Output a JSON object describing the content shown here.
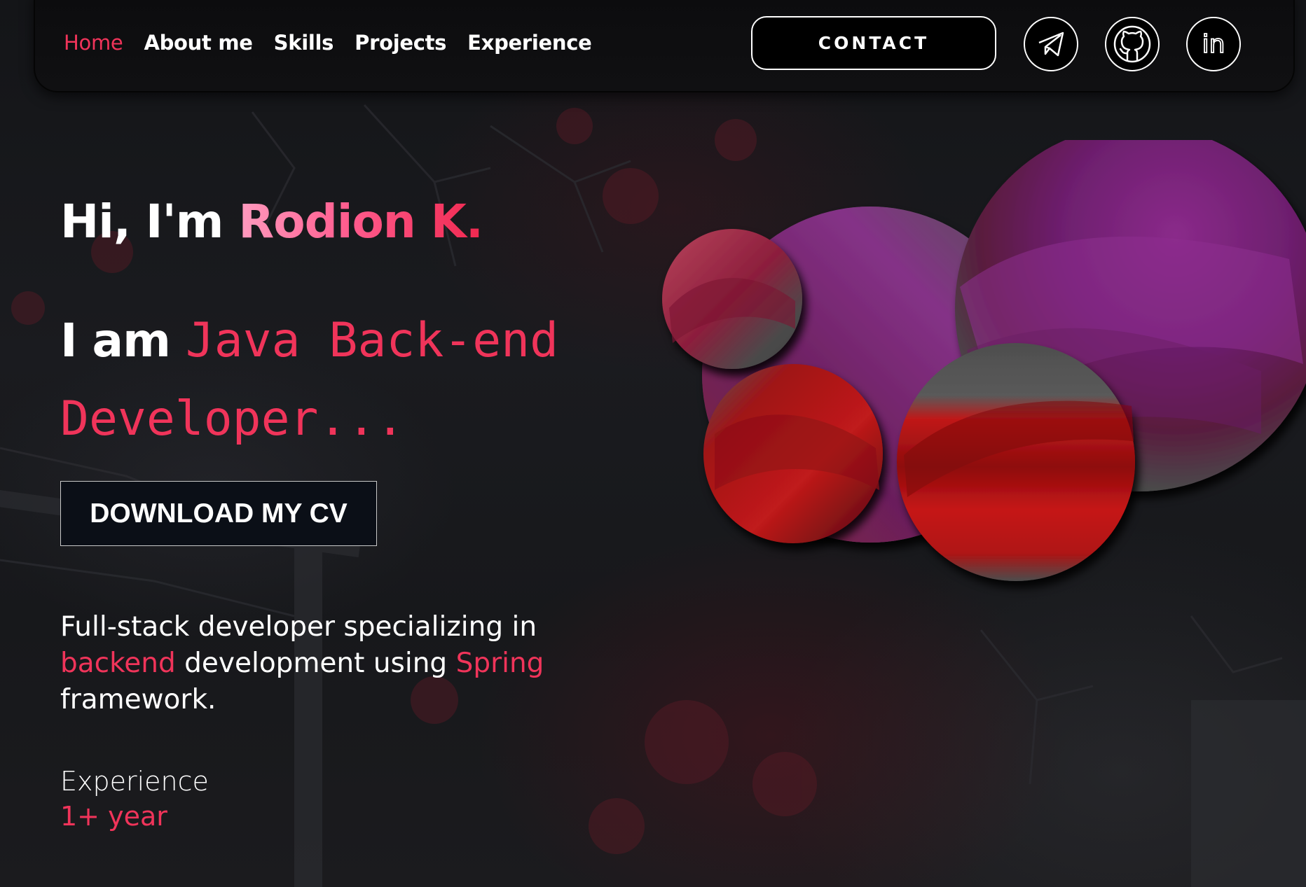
{
  "nav": {
    "links": [
      "Home",
      "About me",
      "Skills",
      "Projects",
      "Experience"
    ],
    "active": "Home",
    "contact_label": "CONTACT",
    "social": [
      "telegram-icon",
      "github-icon",
      "linkedin-icon"
    ]
  },
  "hero": {
    "greeting_prefix": "Hi, I'm ",
    "name": "Rodion K.",
    "role_prefix": "I am ",
    "role_typed": "Java Back-end Developer...",
    "cv_button": "DOWNLOAD MY CV",
    "description": {
      "part1": "Full-stack developer specializing in ",
      "highlight1": "backend",
      "part2": " development using ",
      "highlight2": "Spring",
      "part3": " framework."
    },
    "experience_label": "Experience",
    "experience_value": "1+ year"
  },
  "colors": {
    "accent": "#f0345a",
    "background": "#121316",
    "button_bg": "#0b0f17"
  }
}
